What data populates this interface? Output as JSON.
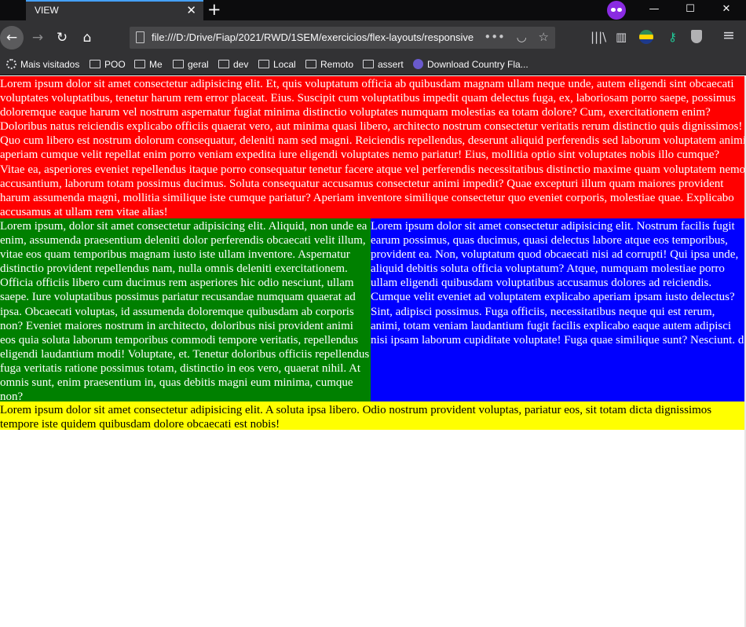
{
  "browser": {
    "tab_title": "VIEW",
    "tab_close": "✕",
    "new_tab": "+",
    "url": "file:///D:/Drive/Fiap/2021/RWD/1SEM/exercicios/flex-layouts/responsive",
    "window_controls": {
      "minimize": "—",
      "maximize": "☐",
      "close": "✕"
    },
    "nav": {
      "back": "←",
      "forward": "→",
      "reload": "↻",
      "home": "⌂"
    },
    "url_actions": {
      "more": "•••",
      "pocket": "◡",
      "bookmark": "☆"
    },
    "toolbar": {
      "library": "|||\\",
      "sidebar": "▥",
      "menu": "≡"
    }
  },
  "bookmarks": [
    {
      "label": "Mais visitados",
      "icon": "gear-icon"
    },
    {
      "label": "POO",
      "icon": "folder-icon"
    },
    {
      "label": "Me",
      "icon": "folder-icon"
    },
    {
      "label": "geral",
      "icon": "folder-icon"
    },
    {
      "label": "dev",
      "icon": "folder-icon"
    },
    {
      "label": "Local",
      "icon": "folder-icon"
    },
    {
      "label": "Remoto",
      "icon": "folder-icon"
    },
    {
      "label": "assert",
      "icon": "folder-icon"
    },
    {
      "label": "Download Country Fla...",
      "icon": "globe-icon"
    }
  ],
  "content": {
    "red_text": "Lorem ipsum dolor sit amet consectetur adipisicing elit. Et, quis voluptatum officia ab quibusdam magnam ullam neque unde, autem eligendi sint obcaecati voluptates voluptatibus, tenetur harum rem error placeat. Eius. Suscipit cum voluptatibus impedit quam delectus fuga, ex, laboriosam porro saepe, possimus doloremque eaque harum vel nostrum aspernatur fugiat minima distinctio voluptates numquam molestias ea totam dolore? Cum, exercitationem enim? Doloribus natus reiciendis explicabo officiis quaerat vero, aut minima quasi libero, architecto nostrum consectetur veritatis rerum distinctio quis dignissimos! Quo cum libero est nostrum dolorum consequatur, deleniti nam sed magni. Reiciendis repellendus, deserunt aliquid perferendis sed laborum voluptatem animi aperiam cumque velit repellat enim porro veniam expedita iure eligendi voluptates nemo pariatur! Eius, mollitia optio sint voluptates nobis illo cumque? Vitae ea, asperiores eveniet repellendus itaque porro consequatur tenetur facere atque vel perferendis necessitatibus distinctio maxime quam voluptatem nemo accusantium, laborum totam possimus ducimus. Soluta consequatur accusamus consectetur animi impedit? Quae excepturi illum quam maiores provident harum assumenda magni, mollitia similique iste cumque pariatur? Aperiam inventore similique consectetur quo eveniet corporis, molestiae quae. Explicabo accusamus at ullam rem vitae alias!",
    "green_text": "Lorem ipsum, dolor sit amet consectetur adipisicing elit. Aliquid, non unde ea enim, assumenda praesentium deleniti dolor perferendis obcaecati velit illum, vitae eos quam temporibus magnam iusto iste ullam inventore. Aspernatur distinctio provident repellendus nam, nulla omnis deleniti exercitationem. Officia officiis libero cum ducimus rem asperiores hic odio nesciunt, ullam saepe. Iure voluptatibus possimus pariatur recusandae numquam quaerat ad ipsa. Obcaecati voluptas, id assumenda doloremque quibusdam ab corporis non? Eveniet maiores nostrum in architecto, doloribus nisi provident animi eos quia soluta laborum temporibus commodi tempore veritatis, repellendus eligendi laudantium modi! Voluptate, et. Tenetur doloribus officiis repellendus fuga veritatis ratione possimus totam, distinctio in eos vero, quaerat nihil. At omnis sunt, enim praesentium in, quas debitis magni eum minima, cumque non?",
    "blue_text": "Lorem ipsum dolor sit amet consectetur adipisicing elit. Nostrum facilis fugit earum possimus, quas ducimus, quasi delectus labore atque eos temporibus, provident ea. Non, voluptatum quod obcaecati nisi ad corrupti! Qui ipsa unde, aliquid debitis soluta officia voluptatum? Atque, numquam molestiae porro ullam eligendi quibusdam voluptatibus accusamus dolores ad reiciendis. Cumque velit eveniet ad voluptatem explicabo aperiam ipsam iusto delectus? Sint, adipisci possimus. Fuga officiis, necessitatibus neque qui est rerum, animi, totam veniam laudantium fugit facilis explicabo eaque autem adipisci nisi ipsam laborum cupiditate voluptate! Fuga quae similique sunt? Nesciunt. d",
    "yellow_text": "Lorem ipsum dolor sit amet consectetur adipisicing elit. A soluta ipsa libero. Odio nostrum provident voluptas, pariatur eos, sit totam dicta dignissimos tempore iste quidem quibusdam dolore obcaecati est nobis!"
  }
}
